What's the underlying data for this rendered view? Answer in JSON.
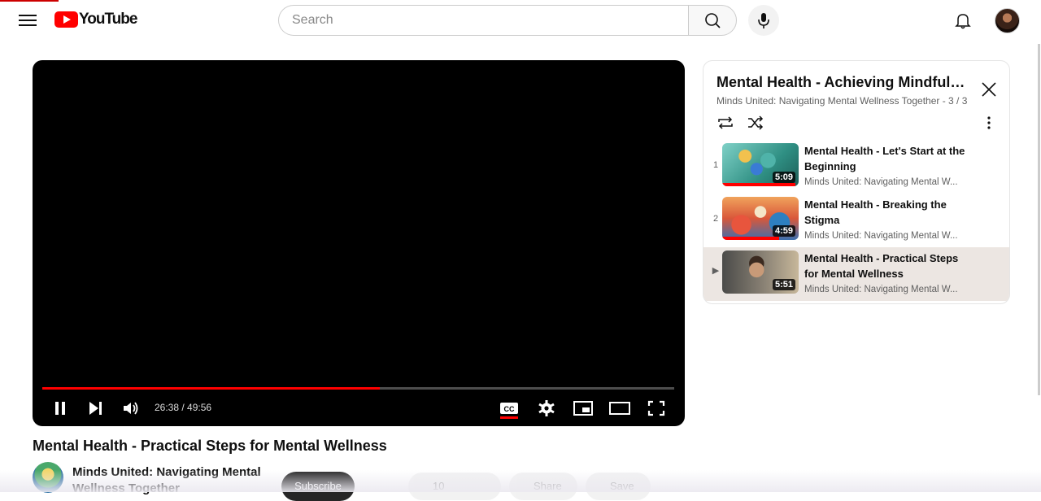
{
  "header": {
    "logo_text": "YouTube",
    "search_placeholder": "Search"
  },
  "player": {
    "time_display": "26:38 / 49:56",
    "progress_fraction": 0.534,
    "cc_label": "CC"
  },
  "video": {
    "title": "Mental Health - Practical Steps for Mental Wellness",
    "channel_name": "Minds United: Navigating Mental Wellness Together",
    "subscribe_label": "Subscribe",
    "like_count": "10",
    "share_label": "Share",
    "save_label": "Save"
  },
  "playlist": {
    "title": "Mental Health - Achieving Mindfuln...",
    "subtitle": "Minds United: Navigating Mental Wellness Together - 3 / 3",
    "items": [
      {
        "index": "1",
        "title": "Mental Health - Let's Start at the Beginning",
        "channel": "Minds United: Navigating Mental W...",
        "duration": "5:09",
        "watched_fraction": 0.96,
        "active": false
      },
      {
        "index": "2",
        "title": "Mental Health - Breaking the Stigma",
        "channel": "Minds United: Navigating Mental W...",
        "duration": "4:59",
        "watched_fraction": 0.74,
        "active": false
      },
      {
        "index": "▶",
        "title": "Mental Health - Practical Steps for Mental Wellness",
        "channel": "Minds United: Navigating Mental W...",
        "duration": "5:51",
        "watched_fraction": 0,
        "active": true
      }
    ]
  },
  "colors": {
    "brand_red": "#ff0000",
    "active_row": "#ece6e2"
  }
}
